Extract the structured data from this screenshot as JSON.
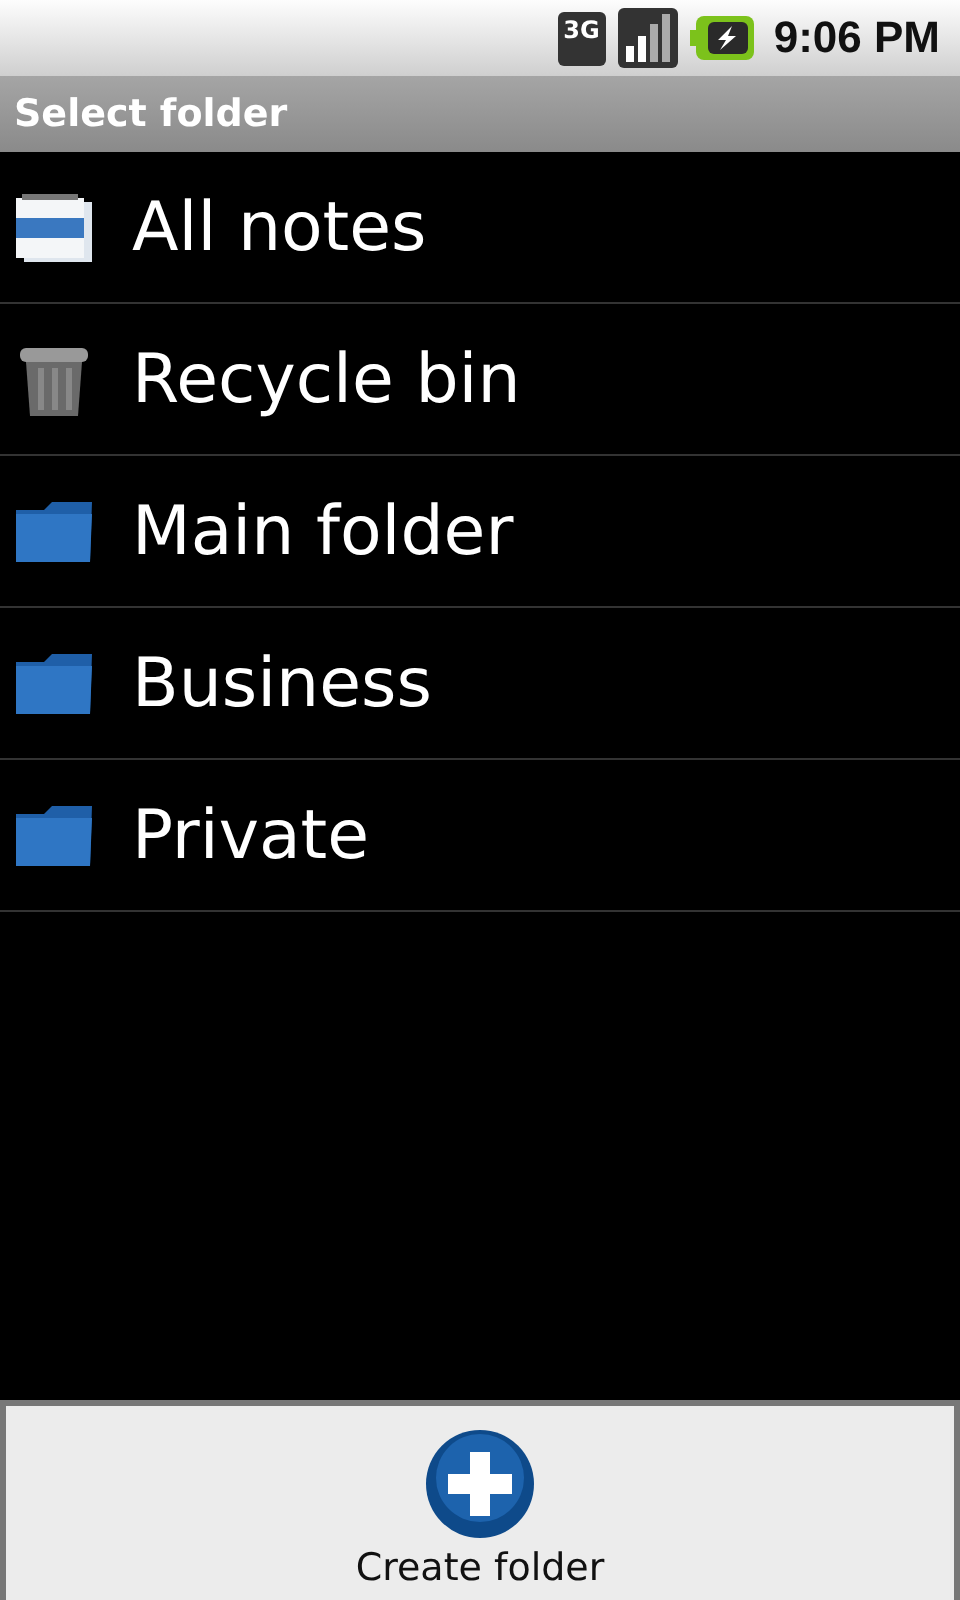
{
  "status_bar": {
    "network": "3G",
    "time": "9:06 PM"
  },
  "title": "Select folder",
  "items": [
    {
      "kind": "notes",
      "label": "All notes"
    },
    {
      "kind": "trash",
      "label": "Recycle bin"
    },
    {
      "kind": "folder",
      "label": "Main folder"
    },
    {
      "kind": "folder",
      "label": "Business"
    },
    {
      "kind": "folder",
      "label": "Private"
    }
  ],
  "create_button": {
    "label": "Create folder"
  }
}
